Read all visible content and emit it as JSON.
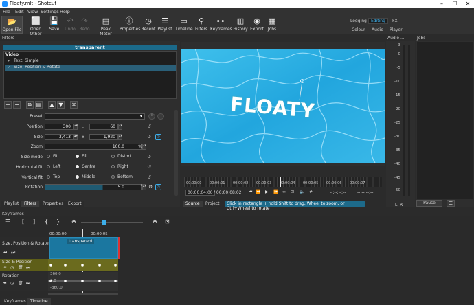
{
  "window": {
    "title": "Floaty.mlt - Shotcut",
    "minimize": "–",
    "maximize": "☐",
    "close": "✕"
  },
  "menu": [
    "File",
    "Edit",
    "View",
    "Settings",
    "Help"
  ],
  "toolbar": [
    {
      "label": "Open File",
      "icon": "📂",
      "selected": true
    },
    {
      "label": "Open Other",
      "icon": "⬜"
    },
    {
      "label": "Save",
      "icon": "💾"
    },
    {
      "label": "Undo",
      "icon": "↶",
      "disabled": true
    },
    {
      "label": "Redo",
      "icon": "↷",
      "disabled": true
    },
    {
      "label": "Peak Meter",
      "icon": "▤"
    },
    {
      "label": "Properties",
      "icon": "ⓘ"
    },
    {
      "label": "Recent",
      "icon": "◷"
    },
    {
      "label": "Playlist",
      "icon": "☰"
    },
    {
      "label": "Timeline",
      "icon": "▭"
    },
    {
      "label": "Filters",
      "icon": "⚲"
    },
    {
      "label": "Keyframes",
      "icon": "⊶"
    },
    {
      "label": "History",
      "icon": "▥"
    },
    {
      "label": "Export",
      "icon": "◉"
    },
    {
      "label": "Jobs",
      "icon": "▦"
    }
  ],
  "layouts": {
    "row1": [
      "Logging",
      "Editing",
      "FX"
    ],
    "row2": [
      "Colour",
      "Audio",
      "Player"
    ]
  },
  "filters_panel": {
    "header": "Filters",
    "clip_name": "transparent",
    "group": "Video",
    "items": [
      {
        "label": "Text: Simple"
      },
      {
        "label": "Size, Position & Rotate"
      }
    ],
    "buttons": [
      "+",
      "−",
      "⧉",
      "▤",
      "▲",
      "▼",
      "✕"
    ],
    "preset_label": "Preset",
    "position": {
      "label": "Position",
      "x": "300",
      "sep": ",",
      "y": "60"
    },
    "size": {
      "label": "Size",
      "w": "3,413",
      "sep": "x",
      "h": "1,920"
    },
    "zoom": {
      "label": "Zoom",
      "value": "100.0",
      "unit": "%"
    },
    "size_mode": {
      "label": "Size mode",
      "options": [
        "Fit",
        "Fill",
        "Distort"
      ],
      "selected": "Fill"
    },
    "hfit": {
      "label": "Horizontal fit",
      "options": [
        "Left",
        "Centre",
        "Right"
      ],
      "selected": "Centre"
    },
    "vfit": {
      "label": "Vertical fit",
      "options": [
        "Top",
        "Middle",
        "Bottom"
      ],
      "selected": "Middle"
    },
    "rotation": {
      "label": "Rotation",
      "value": "5.0",
      "unit": "°"
    }
  },
  "bottom_tabs": [
    "Playlist",
    "Filters",
    "Properties",
    "Export"
  ],
  "viewer": {
    "overlay_text": "FLOATY",
    "ticks": [
      "00:00:00",
      "00:00:01",
      "00:00:02",
      "00:00:03",
      "00:00:04",
      "00:00:05",
      "00:00:06",
      "00:00:07"
    ],
    "current_time": "00:00:04:00",
    "duration": "/ 00:00:08:02",
    "in_point": "--:--:--:--",
    "out_point": "--:--:--:--",
    "tabs": [
      "Source",
      "Project"
    ],
    "hint": "Click in rectangle + hold Shift to drag, Wheel to zoom, or Ctrl+Wheel to rotate"
  },
  "audio": {
    "header": "Audio ...",
    "scale": [
      "3",
      "0",
      "-5",
      "-10",
      "-15",
      "-20",
      "-25",
      "-30",
      "-35",
      "-40",
      "-45",
      "-50"
    ],
    "channels": [
      "L",
      "R"
    ]
  },
  "jobs": {
    "header": "Jobs",
    "pause": "Pause"
  },
  "keyframes": {
    "header": "Keyframes",
    "ruler": [
      "00:00:00",
      "00:00:05"
    ],
    "clip": "transparent",
    "tracks": [
      {
        "label": "Size, Position & Rotate"
      },
      {
        "label": "Size & Position"
      },
      {
        "label": "Rotation",
        "values": [
          "360.0",
          "0.0",
          "-360.0"
        ]
      }
    ]
  },
  "bottom_tabs2": [
    "Keyframes",
    "Timeline"
  ],
  "colors": {
    "accent": "#3daee9",
    "selected_row": "#2a5f78",
    "keyframe_track": "#6b6b1e"
  }
}
